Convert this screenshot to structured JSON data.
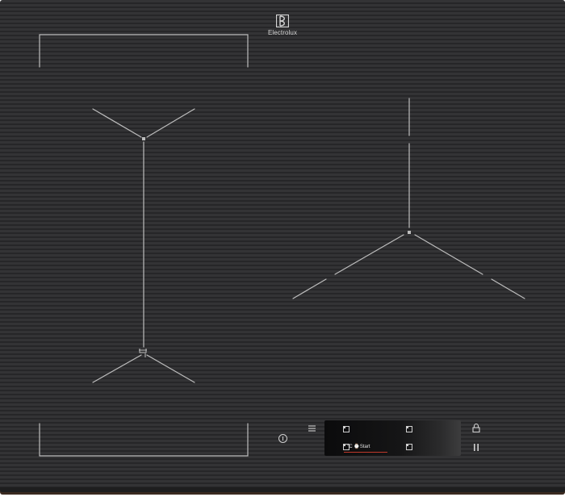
{
  "brand": {
    "name": "Electrolux"
  },
  "display": {
    "start_label": "°C ⌚Start",
    "accent_color": "#c0392b"
  },
  "icons": {
    "menu": "menu-icon",
    "lock": "lock-icon",
    "pause": "pause-icon",
    "power": "power-icon"
  },
  "colors": {
    "glass": "#2d2d2f",
    "markings": "#bdbdbd"
  }
}
